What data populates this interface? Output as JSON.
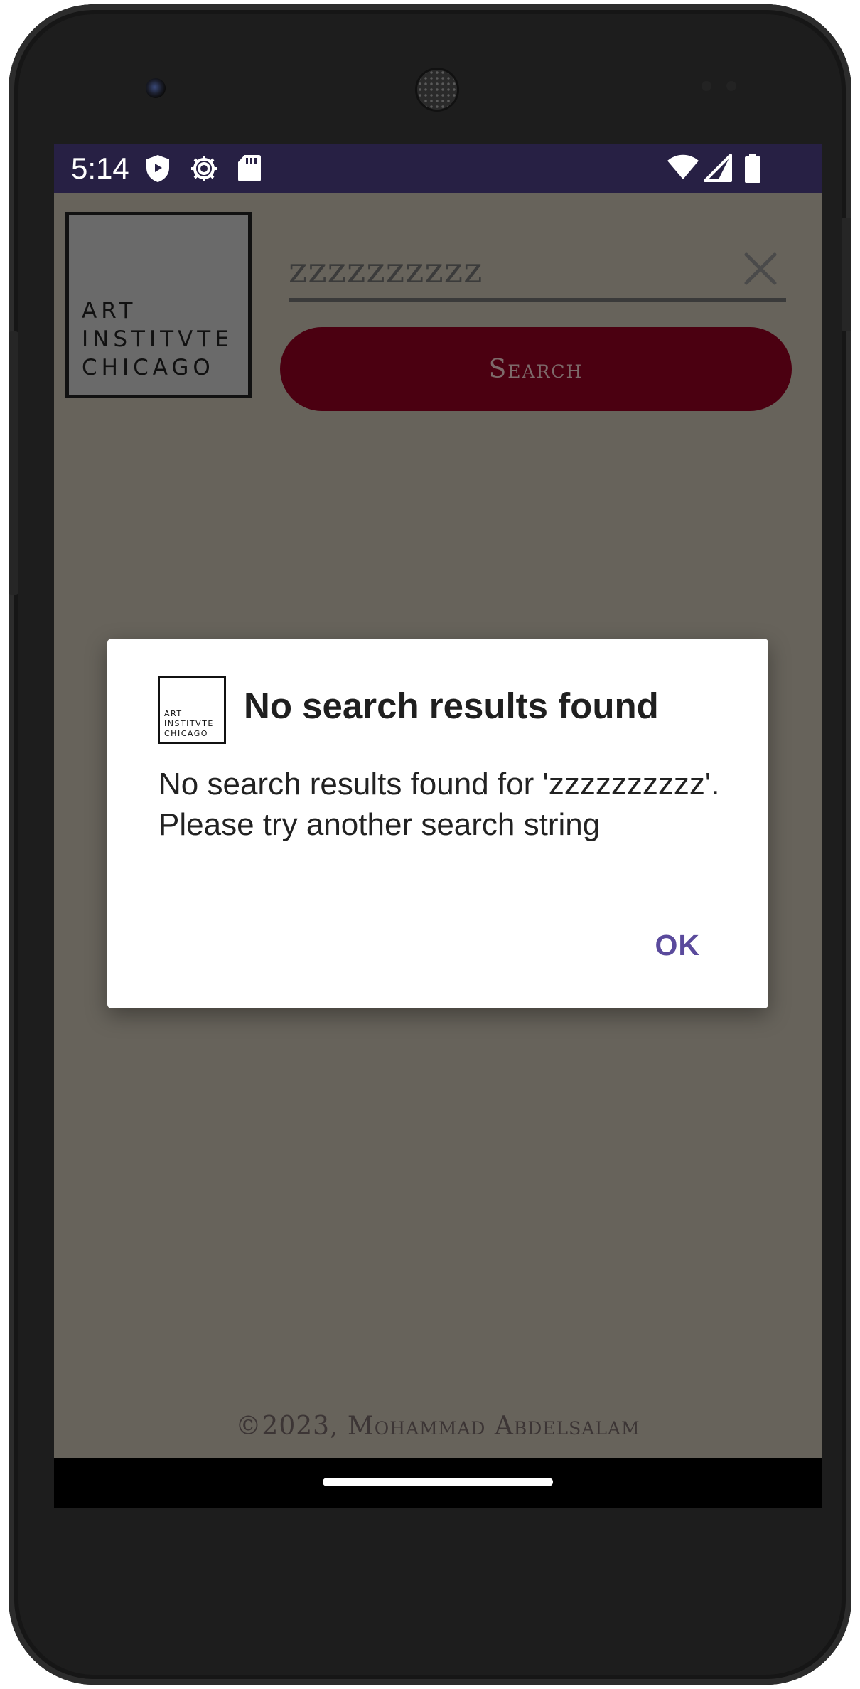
{
  "status_bar": {
    "time": "5:14",
    "left_icons": [
      "shield-icon",
      "gear-icon",
      "sd-card-icon"
    ],
    "right_icons": [
      "wifi-icon",
      "signal-icon",
      "battery-icon"
    ]
  },
  "app": {
    "logo": {
      "lines": [
        "ART",
        "INSTITVTE",
        "CHICAGO"
      ]
    },
    "search": {
      "value": "zzzzzzzzzz",
      "clear_icon": "close-icon",
      "button_label": "Search"
    },
    "footer": "©2023, Mohammad Abdelsalam"
  },
  "dialog": {
    "logo_lines": [
      "ART",
      "INSTITVTE",
      "CHICAGO"
    ],
    "title": "No search results found",
    "message": "No search results found for 'zzzzzzzzzz'. Please try another search string",
    "ok_label": "OK"
  },
  "colors": {
    "status_bar": "#272044",
    "background": "#67635b",
    "search_button": "#4b0011",
    "dialog_accent": "#5a4a9c"
  }
}
